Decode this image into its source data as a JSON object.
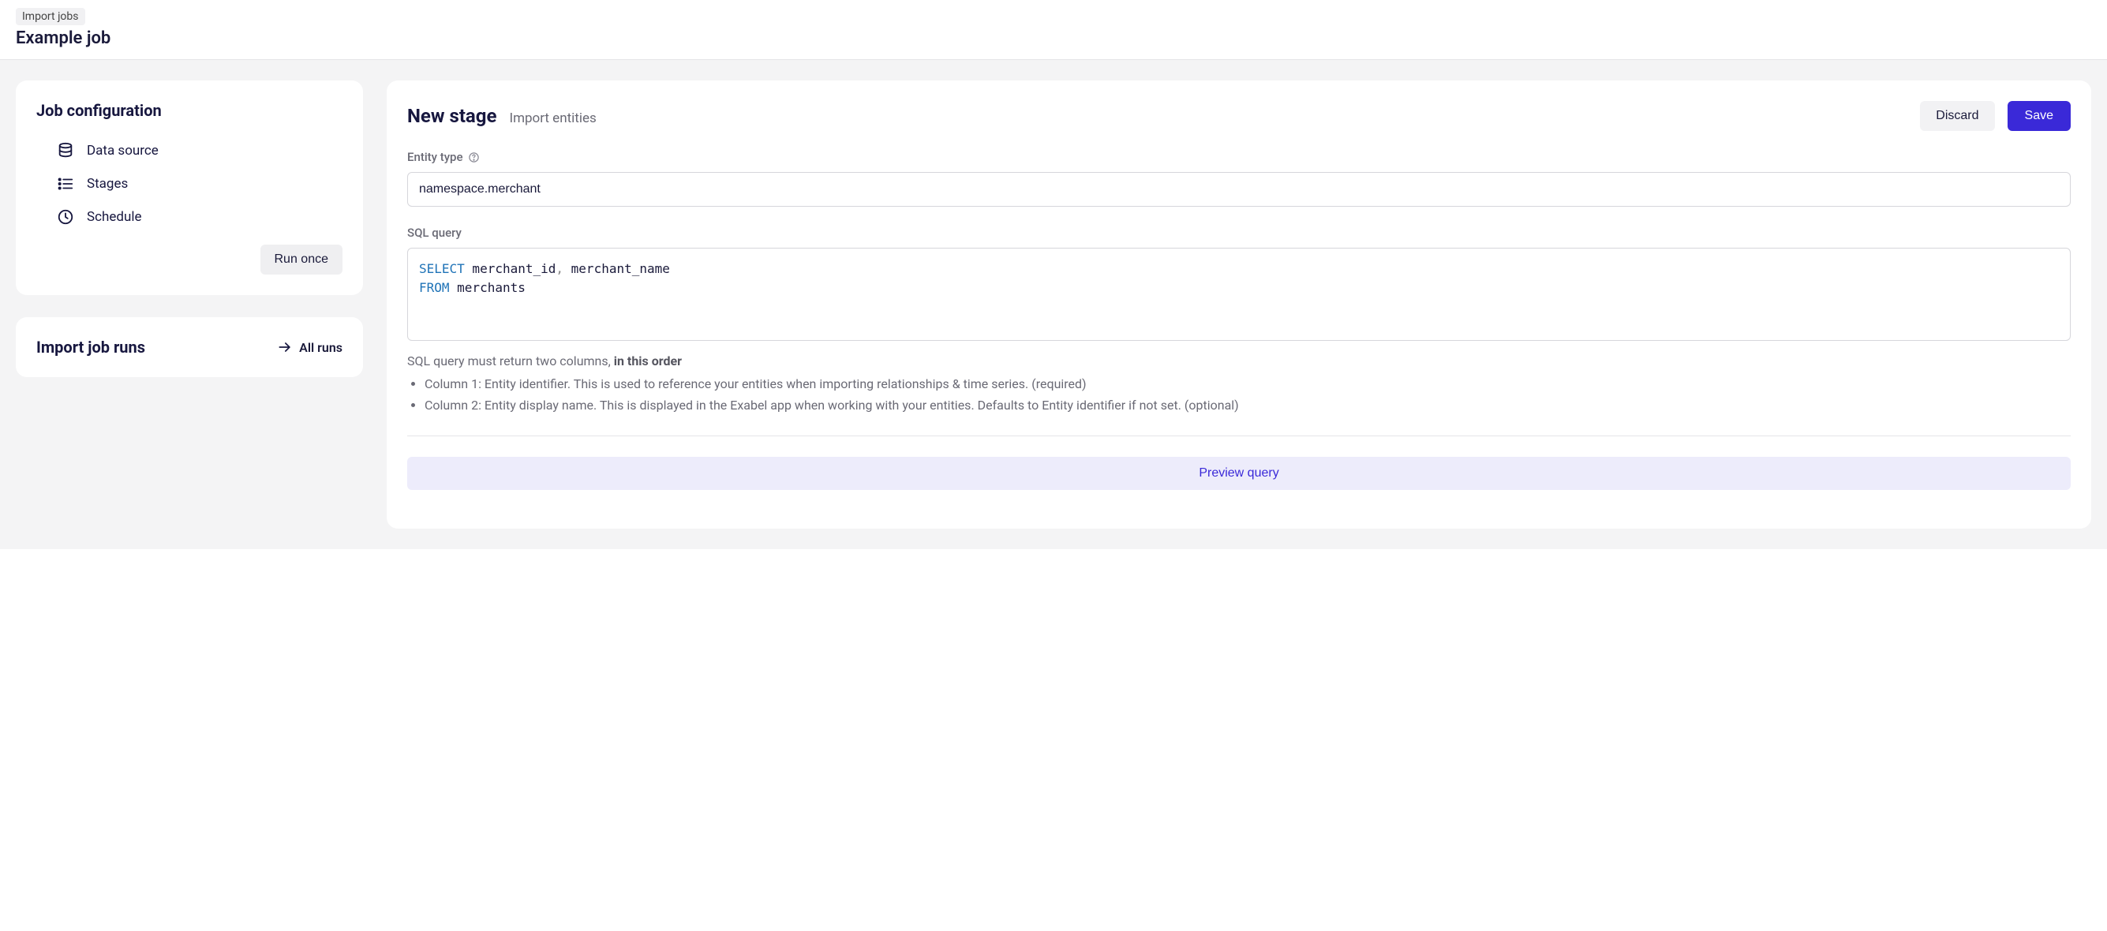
{
  "header": {
    "breadcrumb": "Import jobs",
    "title": "Example job"
  },
  "sidebar": {
    "config_title": "Job configuration",
    "items": [
      {
        "label": "Data source"
      },
      {
        "label": "Stages"
      },
      {
        "label": "Schedule"
      }
    ],
    "run_once": "Run once",
    "runs_title": "Import job runs",
    "all_runs": "All runs"
  },
  "stage": {
    "title": "New stage",
    "subtitle": "Import entities",
    "discard": "Discard",
    "save": "Save",
    "entity_type_label": "Entity type",
    "entity_type_value": "namespace.merchant",
    "sql_label": "SQL query",
    "sql_query": {
      "kw1": "SELECT",
      "cols": " merchant_id",
      "comma": ",",
      "cols2": " merchant_name",
      "kw2": "FROM",
      "table": " merchants"
    },
    "help_prefix": "SQL query must return two columns, ",
    "help_bold": "in this order",
    "help_items": [
      "Column 1: Entity identifier. This is used to reference your entities when importing relationships & time series. (required)",
      "Column 2: Entity display name. This is displayed in the Exabel app when working with your entities. Defaults to Entity identifier if not set. (optional)"
    ],
    "preview": "Preview query"
  }
}
